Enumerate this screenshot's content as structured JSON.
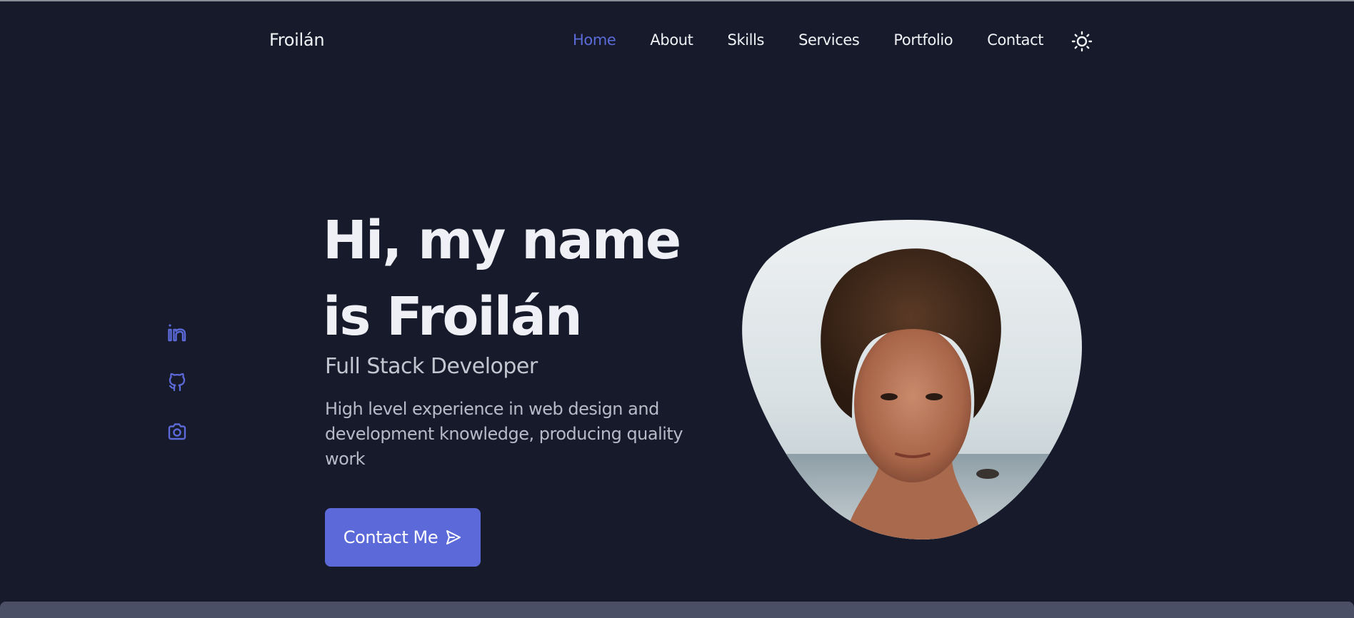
{
  "header": {
    "logo": "Froilán",
    "nav": [
      {
        "label": "Home",
        "active": true
      },
      {
        "label": "About",
        "active": false
      },
      {
        "label": "Skills",
        "active": false
      },
      {
        "label": "Services",
        "active": false
      },
      {
        "label": "Portfolio",
        "active": false
      },
      {
        "label": "Contact",
        "active": false
      }
    ],
    "theme_toggle_icon": "sun-icon"
  },
  "social": [
    {
      "name": "linkedin-icon"
    },
    {
      "name": "github-icon"
    },
    {
      "name": "camera-icon"
    }
  ],
  "hero": {
    "title_line1": "Hi, my name",
    "title_line2": "is Froilán",
    "subtitle": "Full Stack Developer",
    "description": "High level experience in web design and development knowledge, producing quality work",
    "cta_label": "Contact Me",
    "cta_icon": "send-icon"
  },
  "colors": {
    "background": "#161a2a",
    "accent": "#5b6ad8",
    "text": "#eef0f6",
    "muted": "#b8bbc7"
  }
}
